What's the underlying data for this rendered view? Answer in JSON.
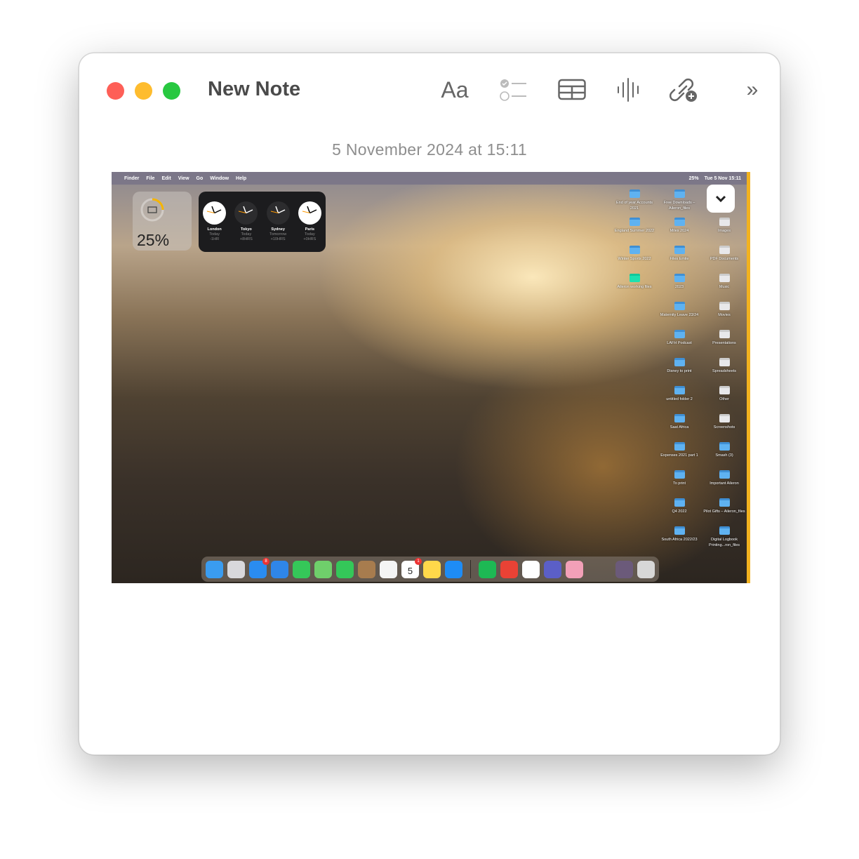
{
  "window": {
    "title": "New Note",
    "date": "5 November 2024 at 15:11",
    "toolbar": [
      {
        "name": "format-icon",
        "label": "Aa"
      },
      {
        "name": "checklist-icon"
      },
      {
        "name": "table-icon"
      },
      {
        "name": "audio-waveform-icon"
      },
      {
        "name": "link-add-icon"
      },
      {
        "name": "more-chevrons-icon"
      }
    ]
  },
  "screenshot": {
    "menubar": {
      "items": [
        "Finder",
        "File",
        "Edit",
        "View",
        "Go",
        "Window",
        "Help"
      ],
      "battery": "25%",
      "datetime": "Tue 5 Nov 15:11"
    },
    "battery_widget": {
      "percent": "25%",
      "level": 0.25,
      "color": "#f5b400"
    },
    "clocks": [
      {
        "city": "London",
        "day": "Today",
        "offset": "-1HR",
        "face": "light"
      },
      {
        "city": "Tokyo",
        "day": "Today",
        "offset": "+8HRS",
        "face": "dark"
      },
      {
        "city": "Sydney",
        "day": "Tomorrow",
        "offset": "+10HRS",
        "face": "dark"
      },
      {
        "city": "Paris",
        "day": "Today",
        "offset": "+0HRS",
        "face": "light"
      }
    ],
    "desktop_columns": [
      [
        "End of year Accounts 2021",
        "England Summer 2022",
        "Winter Sports 2022",
        "Aileron working files"
      ],
      [
        "Free Downloads – Aileron_files",
        "Miles 2024",
        "Files Emile",
        "2023",
        "Maternity Leave 23/24",
        "LAFH Podcast",
        "Disney to print",
        "untitled folder 2",
        "Saat Africa",
        "Expenses 2021 part 1",
        "To print",
        "Q4 2022",
        "South Africa 2022/23"
      ],
      [
        "",
        "Images",
        "PDF Documents",
        "Music",
        "Movies",
        "Presentations",
        "Spreadsheets",
        "Other",
        "Screenshots",
        "Smash (3)",
        "Important Aileron",
        "Pilot Gifts – Aileron_files",
        "Digital Logbook Printing...ron_files"
      ]
    ],
    "dock": [
      {
        "name": "finder",
        "color": "#3a9cf0"
      },
      {
        "name": "launchpad",
        "color": "#d8d8dc"
      },
      {
        "name": "mail",
        "color": "#2a8cf0",
        "badge": "8"
      },
      {
        "name": "safari",
        "color": "#2f86e8"
      },
      {
        "name": "messages",
        "color": "#35c759"
      },
      {
        "name": "maps",
        "color": "#6fcf6b"
      },
      {
        "name": "facetime",
        "color": "#34c759"
      },
      {
        "name": "contacts",
        "color": "#a77c4e"
      },
      {
        "name": "reminders",
        "color": "#f4f4f4"
      },
      {
        "name": "calendar",
        "color": "#ffffff",
        "label": "5",
        "badge": "1"
      },
      {
        "name": "notes",
        "color": "#ffd84a"
      },
      {
        "name": "app-store",
        "color": "#1e8cf5"
      },
      {
        "sep": true
      },
      {
        "name": "spotify",
        "color": "#1db954"
      },
      {
        "name": "chrome",
        "color": "#e94235"
      },
      {
        "name": "slack",
        "color": "#ffffff"
      },
      {
        "name": "teams",
        "color": "#5b5fc7"
      },
      {
        "name": "screen-sharing",
        "color": "#f2a0b8"
      },
      {
        "sep": true
      },
      {
        "name": "downloads-stack",
        "color": "#6b5a7a"
      },
      {
        "name": "trash",
        "color": "#d7d7d7"
      }
    ]
  }
}
